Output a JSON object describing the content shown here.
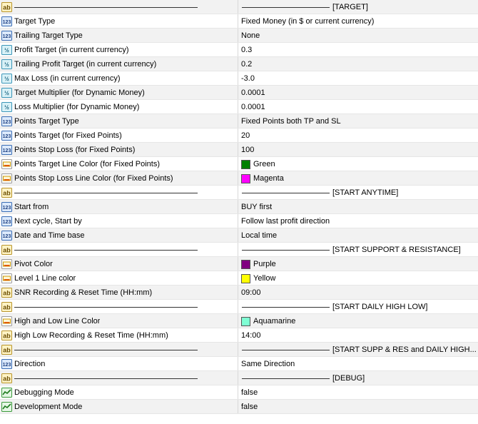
{
  "rows": [
    {
      "kind": "sep",
      "icon": "ab",
      "value": "[TARGET]"
    },
    {
      "kind": "param",
      "icon": "123",
      "label": "Target Type",
      "value": "Fixed Money (in $ or current currency)"
    },
    {
      "kind": "param",
      "icon": "123",
      "label": "Trailing Target Type",
      "value": "None"
    },
    {
      "kind": "param",
      "icon": "v2",
      "label": "Profit Target (in current currency)",
      "value": "0.3"
    },
    {
      "kind": "param",
      "icon": "v2",
      "label": "Trailing Profit Target (in current currency)",
      "value": "0.2"
    },
    {
      "kind": "param",
      "icon": "v2",
      "label": "Max Loss (in current currency)",
      "value": "-3.0"
    },
    {
      "kind": "param",
      "icon": "v2",
      "label": "Target Multiplier (for Dynamic Money)",
      "value": "0.0001"
    },
    {
      "kind": "param",
      "icon": "v2",
      "label": "Loss Multiplier (for Dynamic Money)",
      "value": "0.0001"
    },
    {
      "kind": "param",
      "icon": "123",
      "label": "Points Target Type",
      "value": "Fixed Points both TP and SL"
    },
    {
      "kind": "param",
      "icon": "123",
      "label": "Points Target (for Fixed Points)",
      "value": "20"
    },
    {
      "kind": "param",
      "icon": "123",
      "label": "Points Stop Loss (for Fixed Points)",
      "value": "100"
    },
    {
      "kind": "color",
      "icon": "color",
      "label": "Points Target Line Color (for Fixed Points)",
      "value": "Green",
      "swatch": "#008000"
    },
    {
      "kind": "color",
      "icon": "color",
      "label": "Points Stop Loss Line Color (for Fixed Points)",
      "value": "Magenta",
      "swatch": "#ff00ff"
    },
    {
      "kind": "sep",
      "icon": "ab",
      "value": "[START ANYTIME]"
    },
    {
      "kind": "param",
      "icon": "123",
      "label": "Start from",
      "value": "BUY first"
    },
    {
      "kind": "param",
      "icon": "123",
      "label": "Next cycle, Start by",
      "value": "Follow last profit direction"
    },
    {
      "kind": "param",
      "icon": "123",
      "label": "Date and Time base",
      "value": "Local time"
    },
    {
      "kind": "sep",
      "icon": "ab",
      "value": "[START SUPPORT & RESISTANCE]"
    },
    {
      "kind": "color",
      "icon": "color",
      "label": "Pivot Color",
      "value": "Purple",
      "swatch": "#800080"
    },
    {
      "kind": "color",
      "icon": "color",
      "label": "Level 1 Line color",
      "value": "Yellow",
      "swatch": "#ffff00"
    },
    {
      "kind": "param",
      "icon": "ab",
      "label": "SNR Recording & Reset Time (HH:mm)",
      "value": "09:00"
    },
    {
      "kind": "sep",
      "icon": "ab",
      "value": "[START DAILY HIGH LOW]"
    },
    {
      "kind": "color",
      "icon": "color",
      "label": "High and Low Line Color",
      "value": "Aquamarine",
      "swatch": "#7fffd4"
    },
    {
      "kind": "param",
      "icon": "ab",
      "label": "High Low Recording & Reset Time (HH:mm)",
      "value": "14:00"
    },
    {
      "kind": "sep",
      "icon": "ab",
      "value": "[START SUPP & RES and DAILY HIGH..."
    },
    {
      "kind": "param",
      "icon": "123",
      "label": "Direction",
      "value": "Same Direction"
    },
    {
      "kind": "sep",
      "icon": "ab",
      "value": "[DEBUG]"
    },
    {
      "kind": "param",
      "icon": "bool",
      "label": "Debugging Mode",
      "value": "false"
    },
    {
      "kind": "param",
      "icon": "bool",
      "label": "Development Mode",
      "value": "false"
    }
  ]
}
